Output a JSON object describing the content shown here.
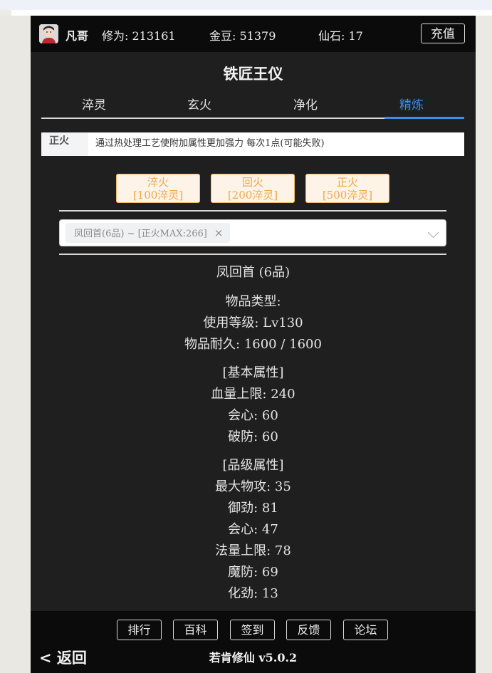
{
  "header": {
    "name": "凡哥",
    "xiuwei": "修为: 213161",
    "jindou": "金豆: 51379",
    "xianshi": "仙石: 17",
    "recharge_label": "充值"
  },
  "title": "铁匠王仪",
  "tabs": [
    {
      "label": "淬灵",
      "active": false
    },
    {
      "label": "玄火",
      "active": false
    },
    {
      "label": "净化",
      "active": false
    },
    {
      "label": "精炼",
      "active": true
    }
  ],
  "description": {
    "label": "正火",
    "text": "通过热处理工艺使附加属性更加强力 每次1点(可能失败)"
  },
  "fire_buttons": [
    {
      "line1": "淬火",
      "line2": "[100淬灵]"
    },
    {
      "line1": "回火",
      "line2": "[200淬灵]"
    },
    {
      "line1": "正火",
      "line2": "[500淬灵]"
    }
  ],
  "select": {
    "tag": "凤回首(6品) ~ [正火MAX:266]",
    "tag_close": "×"
  },
  "item": {
    "name": "凤回首 (6品)",
    "type": "物品类型:",
    "level": "使用等级: Lv130",
    "durability": "物品耐久: 1600 / 1600",
    "basic_header": "[基本属性]",
    "basic": [
      "血量上限: 240",
      "会心: 60",
      "破防: 60"
    ],
    "grade_header": "[品级属性]",
    "grade": [
      "最大物攻: 35",
      "御劲: 81",
      "会心: 47",
      "法量上限: 78",
      "魔防: 69",
      "化劲: 13"
    ]
  },
  "footer": {
    "buttons": [
      "排行",
      "百科",
      "签到",
      "反馈",
      "论坛"
    ],
    "back_label": "< 返回",
    "version": "若肯修仙 v5.0.2"
  },
  "colors": {
    "background": "#1f1f1f",
    "bar": "#0b0b0b",
    "accent": "#3a8ee6",
    "fire_button_text": "#f0a64a"
  }
}
